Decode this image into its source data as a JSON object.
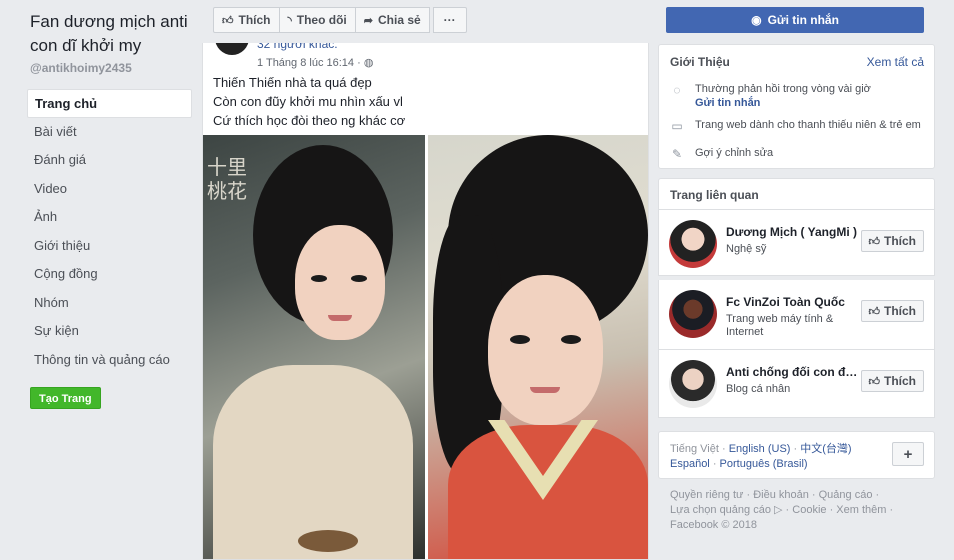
{
  "page": {
    "name": "Fan dương mịch anti con dĩ khởi my",
    "handle": "@antikhoimy2435"
  },
  "nav": [
    "Trang chủ",
    "Bài viết",
    "Đánh giá",
    "Video",
    "Ảnh",
    "Giới thiệu",
    "Cộng đồng",
    "Nhóm",
    "Sự kiện",
    "Thông tin và quảng cáo"
  ],
  "create_page_label": "Tạo Trang",
  "actionbar": {
    "like": "Thích",
    "follow": "Theo dõi",
    "share": "Chia sẻ",
    "more": "···"
  },
  "post": {
    "others": "32 người khác.",
    "time": "1 Tháng 8 lúc 16:14 ·",
    "lines": [
      "Thiến Thiến nhà ta quá đẹp",
      "Còn con đũy khởi mu nhìn xấu vl",
      "Cứ thích học đòi theo ng khác cơ"
    ],
    "calligraphy": "十里桃花"
  },
  "message_button": "Gửi tin nhắn",
  "about": {
    "title": "Giới Thiệu",
    "see_all": "Xem tất cả",
    "response": "Thường phản hồi trong vòng vài giờ",
    "send_message": "Gửi tin nhắn",
    "category": "Trang web dành cho thanh thiếu niên & trẻ em",
    "suggest": "Gợi ý chỉnh sửa"
  },
  "related": {
    "title": "Trang liên quan",
    "like_label": "Thích",
    "items": [
      {
        "name": "Dương Mịch ( YangMi )",
        "category": "Nghệ sỹ"
      },
      {
        "name": "Fc VinZoi Toàn Quốc",
        "category": "Trang web máy tính & Internet"
      },
      {
        "name": "Anti chống đối con điên Khởi My",
        "category": "Blog cá nhân"
      }
    ]
  },
  "languages": {
    "current": "Tiếng Việt",
    "others": [
      "English (US)",
      "中文(台灣)",
      "Español",
      "Português (Brasil)"
    ],
    "sep": " · "
  },
  "footer": {
    "line1": [
      "Quyền riêng tư",
      "Điều khoản",
      "Quảng cáo"
    ],
    "line2": [
      "Lựa chọn quảng cáo",
      "Cookie",
      "Xem thêm"
    ],
    "copyright": "Facebook © 2018"
  },
  "colors": {
    "brand": "#4267b2",
    "link": "#365899",
    "create": "#42b72a",
    "background": "#e9ebee"
  }
}
